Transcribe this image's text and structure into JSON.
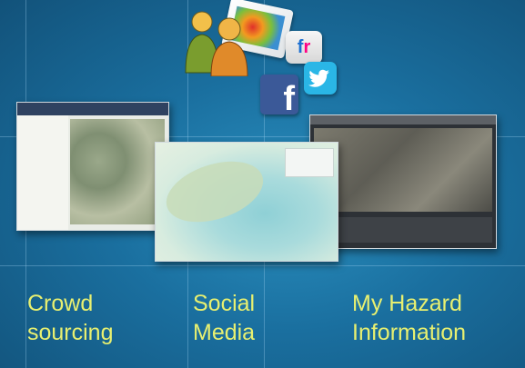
{
  "captions": {
    "crowdsourcing": {
      "line1": "Crowd",
      "line2": "sourcing"
    },
    "social_media": {
      "line1": "Social",
      "line2": "Media"
    },
    "hazard": {
      "line1": "My Hazard",
      "line2": "Information"
    }
  },
  "icons": {
    "flickr": {
      "f": "f",
      "r": "r"
    },
    "facebook": {
      "letter": "f"
    }
  },
  "colors": {
    "background": "#1a6f9f",
    "caption_text": "#e8f070",
    "facebook_blue": "#3b5998",
    "twitter_blue": "#2ab6e6"
  }
}
